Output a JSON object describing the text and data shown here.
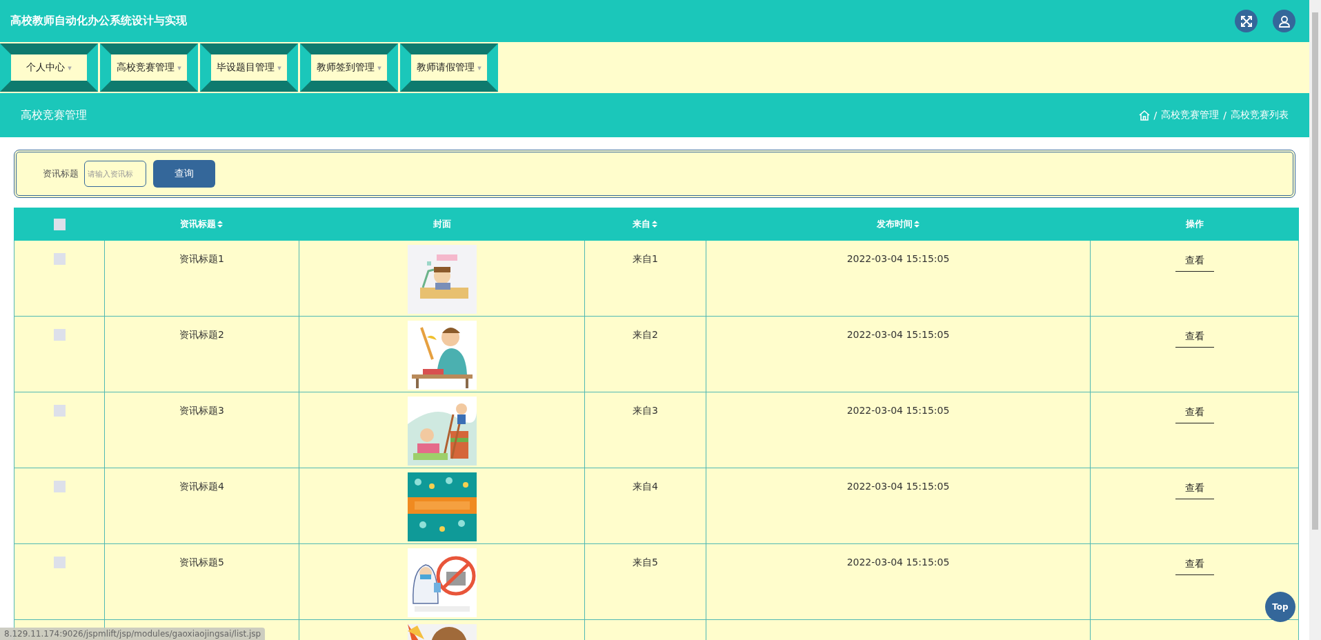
{
  "window": {
    "title": "高校教师自动化办公系统设计与实现"
  },
  "menu": [
    {
      "label": "个人中心",
      "caret": "▾"
    },
    {
      "label": "高校竞赛管理",
      "caret": "▾"
    },
    {
      "label": "毕设题目管理",
      "caret": "▾"
    },
    {
      "label": "教师签到管理",
      "caret": "▾"
    },
    {
      "label": "教师请假管理",
      "caret": "▾"
    }
  ],
  "page_header": {
    "title": "高校竞赛管理",
    "breadcrumb": [
      "高校竞赛管理",
      "高校竞赛列表"
    ],
    "separator": "/"
  },
  "search": {
    "label": "资讯标题",
    "placeholder": "请输入资讯标",
    "button": "查询"
  },
  "table": {
    "select_all": {
      "checked": false
    },
    "columns": [
      {
        "label": "资讯标题",
        "sortable": true
      },
      {
        "label": "封面",
        "sortable": false
      },
      {
        "label": "来自",
        "sortable": true
      },
      {
        "label": "发布时间",
        "sortable": true
      },
      {
        "label": "操作",
        "sortable": false
      }
    ],
    "rows": [
      {
        "checked": false,
        "title": "资讯标题1",
        "cover": {
          "kind": "picture"
        },
        "source": "来自1",
        "time": "2022-03-04 15:15:05",
        "action": "查看"
      },
      {
        "checked": false,
        "title": "资讯标题2",
        "cover": {
          "kind": "picture"
        },
        "source": "来自2",
        "time": "2022-03-04 15:15:05",
        "action": "查看"
      },
      {
        "checked": false,
        "title": "资讯标题3",
        "cover": {
          "kind": "picture"
        },
        "source": "来自3",
        "time": "2022-03-04 15:15:05",
        "action": "查看"
      },
      {
        "checked": false,
        "title": "资讯标题4",
        "cover": {
          "kind": "picture"
        },
        "source": "来自4",
        "time": "2022-03-04 15:15:05",
        "action": "查看"
      },
      {
        "checked": false,
        "title": "资讯标题5",
        "cover": {
          "kind": "picture"
        },
        "source": "来自5",
        "time": "2022-03-04 15:15:05",
        "action": "查看"
      },
      {
        "cover": {
          "kind": "picture"
        }
      }
    ]
  },
  "back_to_top": "Top",
  "status_url": "8.129.11.174:9026/jspmlift/jsp/modules/gaoxiaojingsai/list.jsp"
}
